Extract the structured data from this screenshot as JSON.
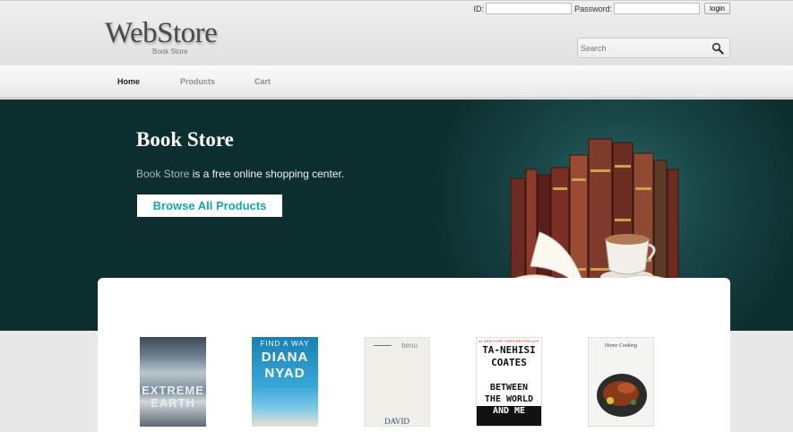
{
  "brand": {
    "name": "WebStore",
    "subtitle": "Book Store"
  },
  "login": {
    "id_label": "ID:",
    "password_label": "Password:",
    "button_label": "login",
    "id_value": "",
    "password_value": ""
  },
  "search": {
    "placeholder": "Search"
  },
  "nav": {
    "items": [
      {
        "label": "Home",
        "active": true
      },
      {
        "label": "Products",
        "active": false
      },
      {
        "label": "Cart",
        "active": false
      }
    ]
  },
  "hero": {
    "title": "Book Store",
    "tagline_highlight": "Book Store",
    "tagline_rest": " is a free online shopping center.",
    "cta_label": "Browse All Products"
  },
  "products": [
    {
      "cover_lines": [
        "EXTREME",
        "EARTH"
      ]
    },
    {
      "cover_lines": [
        "FIND A WAY",
        "DIANA",
        "NYAD"
      ]
    },
    {
      "cover_lines": [
        "benu",
        "DAVID"
      ]
    },
    {
      "cover_lines": [
        "TA-NEHISI",
        "COATES",
        "BETWEEN",
        "THE WORLD",
        "AND ME"
      ],
      "banner": "#1 NEW YORK TIMES BESTSELLER"
    },
    {
      "cover_lines": [
        "Home Cooking"
      ]
    }
  ],
  "colors": {
    "hero_bg": "#0d2e2f",
    "accent": "#10a9b2"
  }
}
